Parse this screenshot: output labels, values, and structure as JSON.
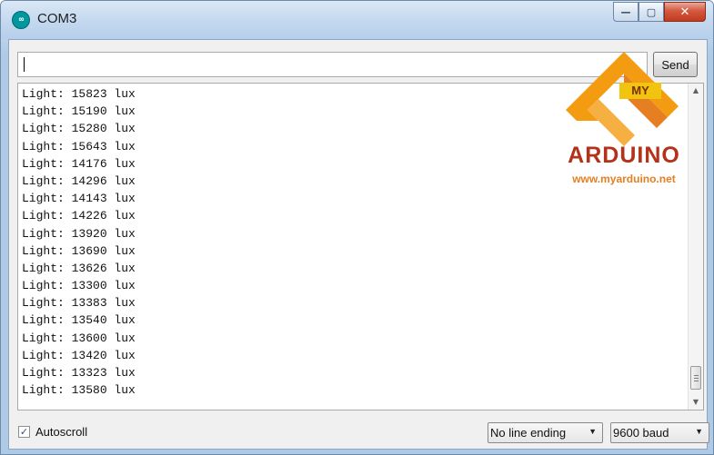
{
  "window": {
    "title": "COM3",
    "app_icon_glyph": "∞",
    "controls": {
      "minimize": "—",
      "maximize": "▢",
      "close": "✕"
    }
  },
  "send_input": {
    "value": "",
    "placeholder": ""
  },
  "send_button": {
    "label": "Send"
  },
  "serial_output": {
    "lines": [
      "Light: 15823 lux",
      "Light: 15190 lux",
      "Light: 15280 lux",
      "Light: 15643 lux",
      "Light: 14176 lux",
      "Light: 14296 lux",
      "Light: 14143 lux",
      "Light: 14226 lux",
      "Light: 13920 lux",
      "Light: 13690 lux",
      "Light: 13626 lux",
      "Light: 13300 lux",
      "Light: 13383 lux",
      "Light: 13540 lux",
      "Light: 13600 lux",
      "Light: 13420 lux",
      "Light: 13323 lux",
      "Light: 13580 lux"
    ]
  },
  "scrollbar": {
    "up": "▲",
    "down": "▼"
  },
  "footer": {
    "autoscroll_label": "Autoscroll",
    "autoscroll_checked": true,
    "checkmark": "✓",
    "line_ending": "No line ending",
    "baud_rate": "9600 baud",
    "dropdown_arrow": "▼"
  },
  "watermark": {
    "tag": "MY",
    "title": "ARDUINO",
    "url": "www.myarduino.net",
    "colors": {
      "orange": "#f39c12",
      "red": "#b4321a",
      "yellow": "#f1c40f"
    }
  }
}
